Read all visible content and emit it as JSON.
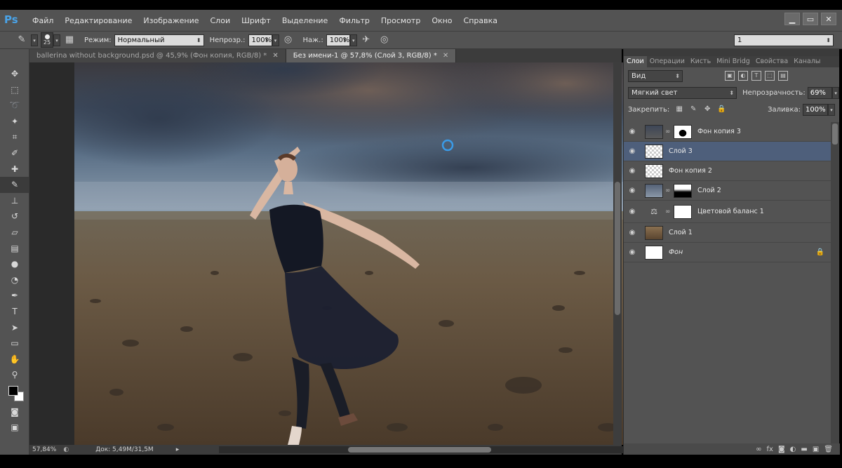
{
  "app": {
    "logo": "Ps"
  },
  "menu": [
    "Файл",
    "Редактирование",
    "Изображение",
    "Слои",
    "Шрифт",
    "Выделение",
    "Фильтр",
    "Просмотр",
    "Окно",
    "Справка"
  ],
  "window_controls": {
    "minimize": "▁",
    "maximize": "▭",
    "close": "✕"
  },
  "options": {
    "brush_size": "25",
    "mode_label": "Режим:",
    "mode_value": "Нормальный",
    "opacity_label": "Непрозр.:",
    "opacity_value": "100%",
    "flow_label": "Наж.:",
    "flow_value": "100%",
    "workspace_value": "1"
  },
  "tabs": [
    {
      "label": "ballerina without background.psd @ 45,9% (Фон копия, RGB/8) *",
      "active": false
    },
    {
      "label": "Без имени-1 @ 57,8% (Слой 3, RGB/8) *",
      "active": true
    }
  ],
  "tools": [
    "move-icon",
    "marquee-icon",
    "lasso-icon",
    "quick-select-icon",
    "crop-icon",
    "eyedropper-icon",
    "healing-icon",
    "brush-icon",
    "stamp-icon",
    "history-brush-icon",
    "eraser-icon",
    "gradient-icon",
    "blur-icon",
    "dodge-icon",
    "pen-icon",
    "type-icon",
    "path-select-icon",
    "shape-icon",
    "hand-icon",
    "zoom-icon"
  ],
  "status": {
    "zoom": "57,84%",
    "doc": "Док: 5,49M/31,5M"
  },
  "panel": {
    "tabs": [
      "Слои",
      "Операции",
      "Кисть",
      "Mini Bridg",
      "Свойства",
      "Каналы"
    ],
    "filter_kind": "Вид",
    "blend_mode": "Мягкий свет",
    "opacity_label": "Непрозрачность:",
    "opacity_value": "69%",
    "lock_label": "Закрепить:",
    "fill_label": "Заливка:",
    "fill_value": "100%",
    "layers": [
      {
        "name": "Фон копия 3",
        "selected": false,
        "thumb": "sky-dark",
        "mask": "silhouette"
      },
      {
        "name": "Слой 3",
        "selected": true,
        "thumb": "transparent",
        "mask": null
      },
      {
        "name": "Фон копия 2",
        "selected": false,
        "thumb": "transparent",
        "mask": null
      },
      {
        "name": "Слой 2",
        "selected": false,
        "thumb": "sky",
        "mask": "gradient"
      },
      {
        "name": "Цветовой баланс 1",
        "selected": false,
        "thumb": "adjustment",
        "mask": "white"
      },
      {
        "name": "Слой 1",
        "selected": false,
        "thumb": "ground",
        "mask": null
      },
      {
        "name": "Фон",
        "selected": false,
        "thumb": "white",
        "mask": null,
        "locked": true
      }
    ]
  }
}
